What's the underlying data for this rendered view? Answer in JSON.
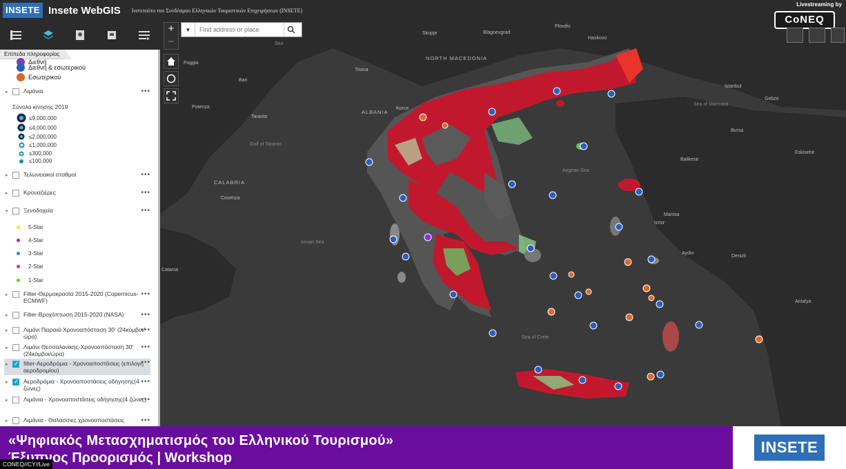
{
  "header": {
    "logo": "INSETE",
    "title": "Insete WebGIS",
    "subtitle": "Ινστιτούτο του Συνδέσμου Ελληνικών Τουριστικών Επιχειρήσεων (INSETE)",
    "livestream": "Livestreaming by"
  },
  "toolbar": {
    "icons": [
      "list-icon",
      "layers-icon",
      "legend-icon",
      "print-icon",
      "menu-icon"
    ]
  },
  "panel": {
    "tab_label": "Επίπεδα πληροφορίας",
    "top_legend": [
      {
        "label": "Διεθνή",
        "color": "#7a3fb0"
      },
      {
        "label": "Διεθνή & εσωτερικού",
        "color": "#2a5fbf"
      },
      {
        "label": "Εσωτερικού",
        "color": "#e0672a"
      }
    ],
    "size_legend_title": "Σύνολο κίνησης 2019",
    "size_legend": [
      "≤9,000,000",
      "≤4,000,000",
      "≤2,000,000",
      "≤1,000,000",
      "≤300,000",
      "≤100,000"
    ],
    "star_legend": [
      {
        "label": "5-Star",
        "color": "#f0f000"
      },
      {
        "label": "4-Star",
        "color": "#a020f0"
      },
      {
        "label": "3-Star",
        "color": "#1a9bb0"
      },
      {
        "label": "2-Star",
        "color": "#e03060"
      },
      {
        "label": "1-Star",
        "color": "#60d020"
      }
    ],
    "layers": [
      {
        "label": "Λιμάνια",
        "checked": false
      },
      {
        "label": "Τελωνειακοί σταθμοί",
        "checked": false
      },
      {
        "label": "Κρουαζιέρες",
        "checked": false
      },
      {
        "label": "Ξενοδοχεία",
        "checked": false
      },
      {
        "label": "Filter-Θερμοκρασία 2015-2020 (Copernicus-ECMWF)",
        "checked": false
      },
      {
        "label": "Filter-Βροχόπτωση 2015-2020 (NASA)",
        "checked": false
      },
      {
        "label": "Λιμάνι Πειραιά-Χρονοαπόσταση 30' (24κόμβοι/ώρα)",
        "checked": false
      },
      {
        "label": "Λιμάνι Θεσσαλονίκης-Χρονοαπόσταση 30' (24κόμβοι/ώρα)",
        "checked": false
      },
      {
        "label": "filter-Αεροδρόμια - Χρονοαποστάσεις (επιλογή αεροδρομίου)",
        "checked": true
      },
      {
        "label": "Αεροδρόμια - Χρονοαποστάσεις οδήγησης(4 ζώνες)",
        "checked": true
      },
      {
        "label": "Λιμάνια - Χρονοαποστάσεις οδήγησης(4 ζώνες)",
        "checked": false
      },
      {
        "label": "Λιμάνια - Θαλάσσιες χρονοαποστάσεις",
        "checked": false
      }
    ],
    "more": "•••"
  },
  "map": {
    "zoom_in": "+",
    "zoom_out": "−",
    "search_placeholder": "Find address or place",
    "labels": [
      {
        "t": "Sea",
        "c": "water"
      },
      {
        "t": "Skopje",
        "c": ""
      },
      {
        "t": "Blagoevgrad",
        "c": ""
      },
      {
        "t": "Plovdiv",
        "c": ""
      },
      {
        "t": "Haskovo",
        "c": ""
      },
      {
        "t": "NORTH MACEDONIA",
        "c": "country"
      },
      {
        "t": "Tirana",
        "c": ""
      },
      {
        "t": "Bari",
        "c": ""
      },
      {
        "t": "ALBANIA",
        "c": "country"
      },
      {
        "t": "Korce",
        "c": ""
      },
      {
        "t": "Istanbul",
        "c": ""
      },
      {
        "t": "Gebze",
        "c": ""
      },
      {
        "t": "Sea of Marmara",
        "c": "water"
      },
      {
        "t": "Bursa",
        "c": ""
      },
      {
        "t": "Eskisehir",
        "c": ""
      },
      {
        "t": "Balikesir",
        "c": ""
      },
      {
        "t": "Aegean Sea",
        "c": "water"
      },
      {
        "t": "Manisa",
        "c": ""
      },
      {
        "t": "Izmir",
        "c": ""
      },
      {
        "t": "Aydin",
        "c": ""
      },
      {
        "t": "Denizli",
        "c": ""
      },
      {
        "t": "Antalya",
        "c": ""
      },
      {
        "t": "Ionian Sea",
        "c": "water"
      },
      {
        "t": "Sea of Crete",
        "c": "water"
      },
      {
        "t": "Gulf of Taranto",
        "c": "water"
      },
      {
        "t": "Catania",
        "c": ""
      },
      {
        "t": "Foggia",
        "c": ""
      },
      {
        "t": "Taranto",
        "c": ""
      },
      {
        "t": "Potenza",
        "c": ""
      },
      {
        "t": "Cosenza",
        "c": ""
      },
      {
        "t": "CALABRIA",
        "c": "country"
      }
    ]
  },
  "logos": {
    "coneq": "CoNEQ",
    "insete": "INSETE"
  },
  "banner": {
    "line1": "«Ψηφιακός Μετασχηματισμός του Ελληνικού Τουρισμού»",
    "line2": "Έξυπνος Προορισμός | Workshop"
  },
  "credit": "CONEQ//CY//Live"
}
